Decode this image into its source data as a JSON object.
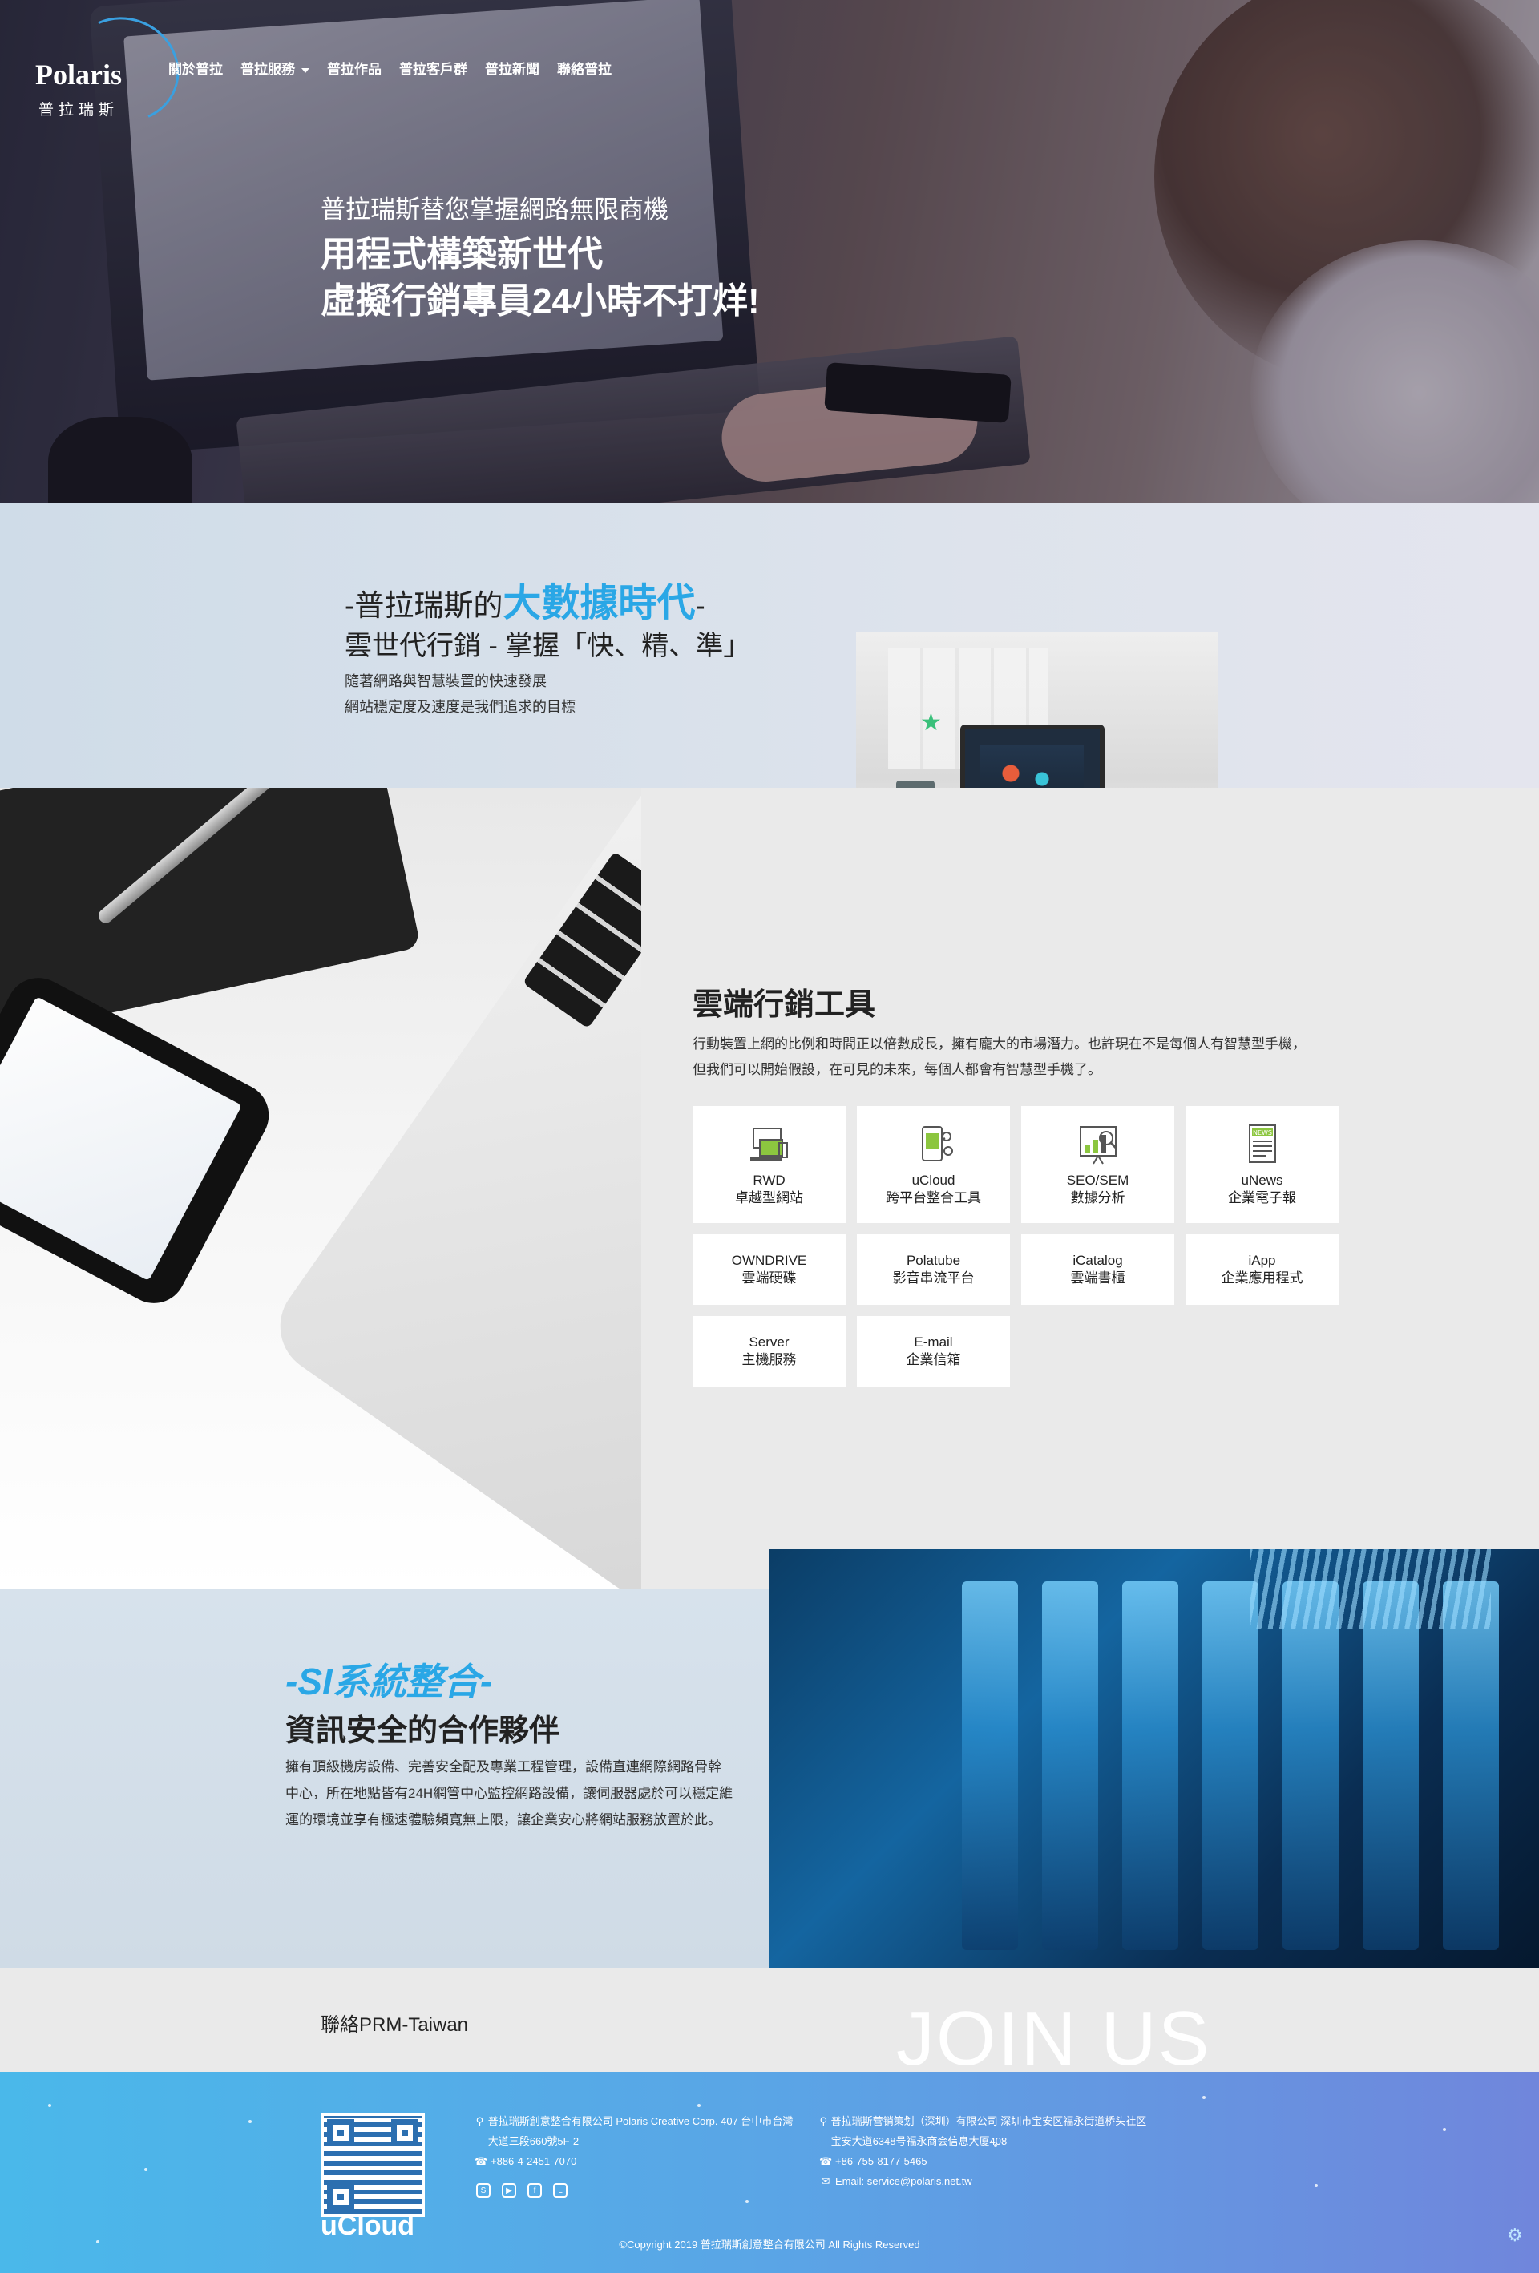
{
  "brand": {
    "name": "Polaris",
    "sub": "普拉瑞斯"
  },
  "nav": {
    "items": [
      "關於普拉",
      "普拉服務",
      "普拉作品",
      "普拉客戶群",
      "普拉新聞",
      "聯絡普拉"
    ]
  },
  "hero": {
    "line1": "普拉瑞斯替您掌握網路無限商機",
    "line2": "用程式構築新世代",
    "line3": "虛擬行銷專員24小時不打烊!"
  },
  "bigdata": {
    "title_prefix": "-普拉瑞斯的",
    "title_highlight": "大數據時代",
    "title_suffix": "-",
    "subtitle": "雲世代行銷 - 掌握「快、精、準」",
    "desc1": "隨著網路與智慧裝置的快速發展",
    "desc2": "網站穩定度及速度是我們追求的目標"
  },
  "cloud": {
    "title": "雲端行銷工具",
    "desc1": "行動裝置上網的比例和時間正以倍數成長，擁有龐大的市場潛力。也許現在不是每個人有智慧型手機，",
    "desc2": "但我們可以開始假設，在可見的未來，每個人都會有智慧型手機了。",
    "tiles": [
      {
        "t1": "RWD",
        "t2": "卓越型網站",
        "icon": "responsive-devices-icon"
      },
      {
        "t1": "uCloud",
        "t2": "跨平台整合工具",
        "icon": "cloud-phone-icon"
      },
      {
        "t1": "SEO/SEM",
        "t2": "數據分析",
        "icon": "chart-search-icon"
      },
      {
        "t1": "uNews",
        "t2": "企業電子報",
        "icon": "newsletter-icon"
      },
      {
        "t1": "OWNDRIVE",
        "t2": "雲端硬碟"
      },
      {
        "t1": "Polatube",
        "t2": "影音串流平台"
      },
      {
        "t1": "iCatalog",
        "t2": "雲端書櫃"
      },
      {
        "t1": "iApp",
        "t2": "企業應用程式"
      },
      {
        "t1": "Server",
        "t2": "主機服務"
      },
      {
        "t1": "E-mail",
        "t2": "企業信箱"
      }
    ]
  },
  "si": {
    "title": "-SI系統整合-",
    "subtitle": "資訊安全的合作夥伴",
    "desc": "擁有頂級機房設備、完善安全配及專業工程管理，設備直連網際網路骨幹中心，所在地點皆有24H網管中心監控網路設備，讓伺服器處於可以穩定維運的環境並享有極速體驗頻寬無上限，讓企業安心將網站服務放置於此。"
  },
  "contact": {
    "label": "聯絡PRM-Taiwan",
    "join": "JOIN US"
  },
  "footer": {
    "qr_label": "uCloud",
    "tw_address": "普拉瑞斯創意整合有限公司 Polaris Creative Corp. 407 台中市台灣大道三段660號5F-2",
    "tw_phone": "+886-4-2451-7070",
    "cn_address": "普拉瑞斯营销策划（深圳）有限公司 深圳市宝安区福永街道桥头社区宝安大道6348号福永商会信息大厦408",
    "cn_phone": "+86-755-8177-5465",
    "email": "Email: service@polaris.net.tw",
    "socials": [
      "skype-icon",
      "youtube-icon",
      "facebook-icon",
      "line-icon"
    ],
    "copyright": "©Copyright 2019 普拉瑞斯創意整合有限公司 All Rights Reserved"
  },
  "colors": {
    "accent": "#2aa7e6",
    "footer_start": "#4ab8ea",
    "footer_end": "#7086dc"
  }
}
